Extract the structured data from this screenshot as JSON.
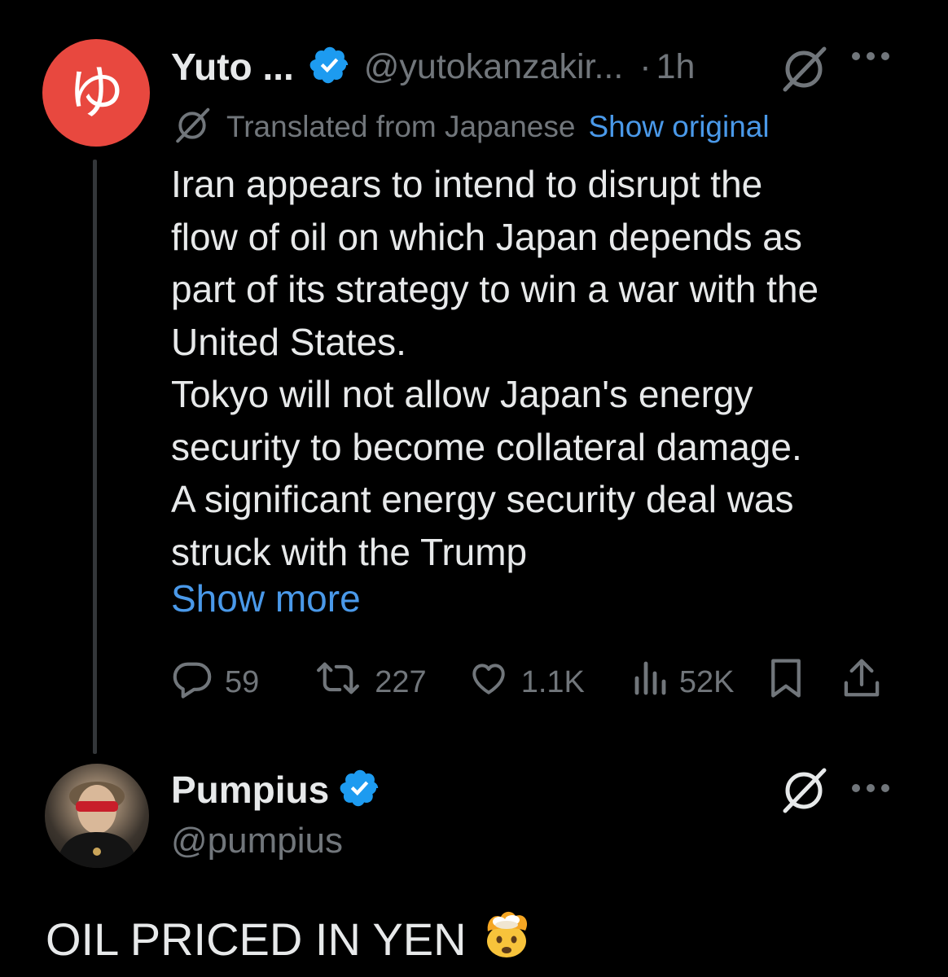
{
  "tweet": {
    "avatar_glyph": "ゆ",
    "display_name": "Yuto ...",
    "handle": "@yutokanzakir...",
    "separator": "·",
    "time": "1h",
    "translated_label": "Translated from Japanese",
    "show_original": "Show original",
    "body_lines": [
      "Iran appears to intend to disrupt the",
      "flow of oil on which Japan depends as",
      "part of its strategy to win a war with the",
      "United States.",
      "Tokyo will not allow Japan's energy",
      "security to become collateral damage.",
      "A significant energy security deal was",
      "struck with the Trump"
    ],
    "show_more": "Show more",
    "stats": {
      "replies": "59",
      "reposts": "227",
      "likes": "1.1K",
      "views": "52K"
    }
  },
  "reply": {
    "display_name": "Pumpius",
    "handle": "@pumpius",
    "text": "OIL PRICED IN YEN"
  },
  "colors": {
    "background": "#000000",
    "text": "#e7e9ea",
    "muted": "#71767b",
    "link": "#4a99e9",
    "verified": "#1d9bf0",
    "avatar_red": "#e8483f"
  },
  "icons": {
    "verified": "verified-badge-icon",
    "grok": "grok-icon",
    "more": "more-icon",
    "reply": "reply-icon",
    "repost": "repost-icon",
    "like": "heart-icon",
    "views": "views-icon",
    "bookmark": "bookmark-icon",
    "share": "share-icon",
    "emoji": "exploding-head-icon"
  }
}
